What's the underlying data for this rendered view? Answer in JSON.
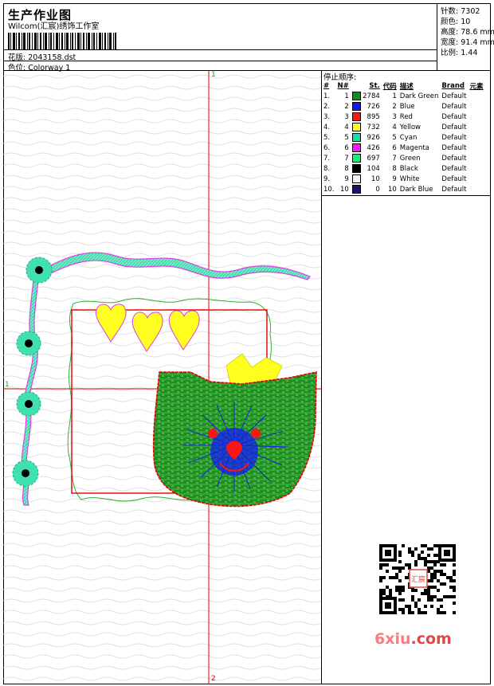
{
  "header": {
    "title": "生产作业图",
    "studio": "Wilcom(汇宸)绣饰工作室",
    "design_label": "花版:",
    "design_value": "2043158.dst",
    "colorway_label": "色位:",
    "colorway_value": "Colorway 1"
  },
  "stats": {
    "stitches_label": "针数:",
    "stitches_value": "7302",
    "colors_label": "颜色:",
    "colors_value": "10",
    "height_label": "高度:",
    "height_value": "78.6 mm",
    "width_label": "宽度:",
    "width_value": "91.4 mm",
    "scale_label": "比例:",
    "scale_value": "1.44"
  },
  "color_table": {
    "title": "停止顺序:",
    "headers": [
      "#",
      "N#",
      "St.",
      "代码",
      "描述",
      "Brand",
      "元素"
    ],
    "rows": [
      {
        "idx": "1.",
        "n": "1",
        "color": "#1a8a1a",
        "st": "2784",
        "code": "1",
        "desc": "Dark Green",
        "brand": "Default"
      },
      {
        "idx": "2.",
        "n": "2",
        "color": "#1414ff",
        "st": "726",
        "code": "2",
        "desc": "Blue",
        "brand": "Default"
      },
      {
        "idx": "3.",
        "n": "3",
        "color": "#ff1414",
        "st": "895",
        "code": "3",
        "desc": "Red",
        "brand": "Default"
      },
      {
        "idx": "4.",
        "n": "4",
        "color": "#ffff14",
        "st": "732",
        "code": "4",
        "desc": "Yellow",
        "brand": "Default"
      },
      {
        "idx": "5.",
        "n": "5",
        "color": "#14e0a0",
        "st": "926",
        "code": "5",
        "desc": "Cyan",
        "brand": "Default"
      },
      {
        "idx": "6.",
        "n": "6",
        "color": "#ff14ff",
        "st": "426",
        "code": "6",
        "desc": "Magenta",
        "brand": "Default"
      },
      {
        "idx": "7.",
        "n": "7",
        "color": "#14f078",
        "st": "697",
        "code": "7",
        "desc": "Green",
        "brand": "Default"
      },
      {
        "idx": "8.",
        "n": "8",
        "color": "#000000",
        "st": "104",
        "code": "8",
        "desc": "Black",
        "brand": "Default"
      },
      {
        "idx": "9.",
        "n": "9",
        "color": "#f4f4f4",
        "st": "10",
        "code": "9",
        "desc": "White",
        "brand": "Default"
      },
      {
        "idx": "10.",
        "n": "10",
        "color": "#141480",
        "st": "0",
        "code": "10",
        "desc": "Dark Blue",
        "brand": "Default"
      }
    ]
  },
  "axes": {
    "top": "1",
    "bottom": "2",
    "left": "1"
  },
  "watermark": {
    "part_a": "6xiu",
    "part_b": ".com",
    "stamp": "汇宸"
  },
  "colors": {
    "axis_red": "#e00000",
    "axis_green": "#18a818"
  }
}
